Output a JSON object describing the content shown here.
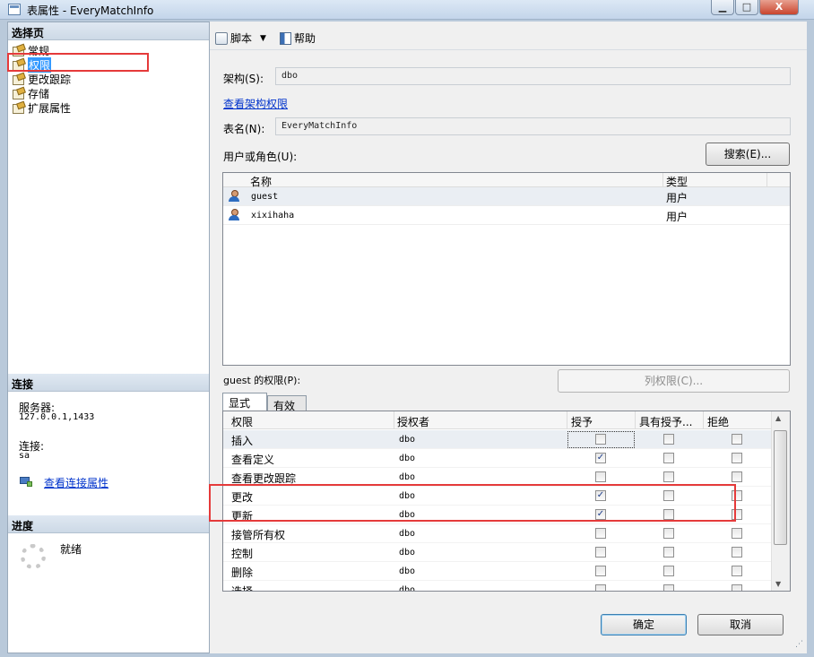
{
  "window": {
    "title": "表属性 - EveryMatchInfo",
    "minimize": "▁",
    "maximize": "□",
    "close": "X"
  },
  "sidebar": {
    "select_page_header": "选择页",
    "pages": [
      {
        "label": "常规"
      },
      {
        "label": "权限",
        "selected": true
      },
      {
        "label": "更改跟踪"
      },
      {
        "label": "存储"
      },
      {
        "label": "扩展属性"
      }
    ],
    "connection": {
      "header": "连接",
      "server_label": "服务器:",
      "server_value": "127.0.0.1,1433",
      "connection_label": "连接:",
      "connection_value": "sa",
      "view_link": "查看连接属性"
    },
    "progress": {
      "header": "进度",
      "status": "就绪"
    }
  },
  "toolbar": {
    "script_label": "脚本",
    "help_label": "帮助"
  },
  "form": {
    "schema_label": "架构(S):",
    "schema_value": "dbo",
    "view_schema_permissions": "查看架构权限",
    "table_name_label": "表名(N):",
    "table_name_value": "EveryMatchInfo",
    "users_roles_label": "用户或角色(U):",
    "search_button": "搜索(E)..."
  },
  "users_grid": {
    "columns": [
      "名称",
      "类型"
    ],
    "rows": [
      {
        "name": "guest",
        "type": "用户"
      },
      {
        "name": "xixihaha",
        "type": "用户"
      }
    ]
  },
  "permissions": {
    "label": "guest 的权限(P):",
    "column_permissions_button": "列权限(C)...",
    "tabs": [
      "显式",
      "有效"
    ],
    "columns": [
      "权限",
      "授权者",
      "授予",
      "具有授予...",
      "拒绝"
    ],
    "rows": [
      {
        "permission": "插入",
        "grantor": "dbo",
        "grant": false,
        "with_grant": false,
        "deny": false
      },
      {
        "permission": "查看定义",
        "grantor": "dbo",
        "grant": true,
        "with_grant": false,
        "deny": false
      },
      {
        "permission": "查看更改跟踪",
        "grantor": "dbo",
        "grant": false,
        "with_grant": false,
        "deny": false
      },
      {
        "permission": "更改",
        "grantor": "dbo",
        "grant": true,
        "with_grant": false,
        "deny": false
      },
      {
        "permission": "更新",
        "grantor": "dbo",
        "grant": true,
        "with_grant": false,
        "deny": false
      },
      {
        "permission": "接管所有权",
        "grantor": "dbo",
        "grant": false,
        "with_grant": false,
        "deny": false
      },
      {
        "permission": "控制",
        "grantor": "dbo",
        "grant": false,
        "with_grant": false,
        "deny": false
      },
      {
        "permission": "删除",
        "grantor": "dbo",
        "grant": false,
        "with_grant": false,
        "deny": false
      },
      {
        "permission": "选择",
        "grantor": "dbo",
        "grant": false,
        "with_grant": false,
        "deny": false
      }
    ]
  },
  "footer": {
    "ok_button": "确定",
    "cancel_button": "取消"
  },
  "colors": {
    "highlight_box": "#e53a3a",
    "selection": "#3399ff",
    "link": "#0033cc"
  }
}
